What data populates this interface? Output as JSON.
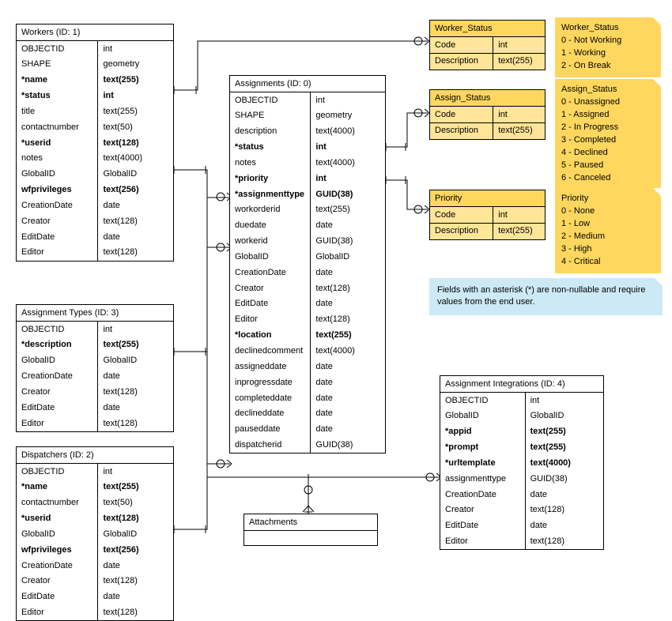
{
  "entities": {
    "workers": {
      "title": "Workers (ID: 1)",
      "fields": [
        {
          "name": "OBJECTID",
          "type": "int",
          "bold": false
        },
        {
          "name": "SHAPE",
          "type": "geometry",
          "bold": false
        },
        {
          "name": "*name",
          "type": "text(255)",
          "bold": true
        },
        {
          "name": "*status",
          "type": "int",
          "bold": true
        },
        {
          "name": "title",
          "type": "text(255)",
          "bold": false
        },
        {
          "name": "contactnumber",
          "type": "text(50)",
          "bold": false
        },
        {
          "name": "*userid",
          "type": "text(128)",
          "bold": true
        },
        {
          "name": "notes",
          "type": "text(4000)",
          "bold": false
        },
        {
          "name": "GlobalID",
          "type": "GlobalID",
          "bold": false
        },
        {
          "name": "wfprivileges",
          "type": "text(256)",
          "bold": true
        },
        {
          "name": "CreationDate",
          "type": "date",
          "bold": false
        },
        {
          "name": "Creator",
          "type": "text(128)",
          "bold": false
        },
        {
          "name": "EditDate",
          "type": "date",
          "bold": false
        },
        {
          "name": "Editor",
          "type": "text(128)",
          "bold": false
        }
      ]
    },
    "assignmentTypes": {
      "title": "Assignment Types (ID: 3)",
      "fields": [
        {
          "name": "OBJECTID",
          "type": "int",
          "bold": false
        },
        {
          "name": "*description",
          "type": "text(255)",
          "bold": true
        },
        {
          "name": "GlobalID",
          "type": "GlobalID",
          "bold": false
        },
        {
          "name": "CreationDate",
          "type": "date",
          "bold": false
        },
        {
          "name": "Creator",
          "type": "text(128)",
          "bold": false
        },
        {
          "name": "EditDate",
          "type": "date",
          "bold": false
        },
        {
          "name": "Editor",
          "type": "text(128)",
          "bold": false
        }
      ]
    },
    "dispatchers": {
      "title": "Dispatchers (ID: 2)",
      "fields": [
        {
          "name": "OBJECTID",
          "type": "int",
          "bold": false
        },
        {
          "name": "*name",
          "type": "text(255)",
          "bold": true
        },
        {
          "name": "contactnumber",
          "type": "text(50)",
          "bold": false
        },
        {
          "name": "*userid",
          "type": "text(128)",
          "bold": true
        },
        {
          "name": "GlobalID",
          "type": "GlobalID",
          "bold": false
        },
        {
          "name": "wfprivileges",
          "type": "text(256)",
          "bold": true
        },
        {
          "name": "CreationDate",
          "type": "date",
          "bold": false
        },
        {
          "name": "Creator",
          "type": "text(128)",
          "bold": false
        },
        {
          "name": "EditDate",
          "type": "date",
          "bold": false
        },
        {
          "name": "Editor",
          "type": "text(128)",
          "bold": false
        }
      ]
    },
    "assignments": {
      "title": "Assignments (ID: 0)",
      "fields": [
        {
          "name": "OBJECTID",
          "type": "int",
          "bold": false
        },
        {
          "name": "SHAPE",
          "type": "geometry",
          "bold": false
        },
        {
          "name": "description",
          "type": "text(4000)",
          "bold": false
        },
        {
          "name": "*status",
          "type": "int",
          "bold": true
        },
        {
          "name": "notes",
          "type": "text(4000)",
          "bold": false
        },
        {
          "name": "*priority",
          "type": "int",
          "bold": true
        },
        {
          "name": "*assignmenttype",
          "type": "GUID(38)",
          "bold": true
        },
        {
          "name": "workorderid",
          "type": "text(255)",
          "bold": false
        },
        {
          "name": "duedate",
          "type": "date",
          "bold": false
        },
        {
          "name": "workerid",
          "type": "GUID(38)",
          "bold": false
        },
        {
          "name": "GlobalID",
          "type": "GlobalID",
          "bold": false
        },
        {
          "name": "CreationDate",
          "type": "date",
          "bold": false
        },
        {
          "name": "Creator",
          "type": "text(128)",
          "bold": false
        },
        {
          "name": "EditDate",
          "type": "date",
          "bold": false
        },
        {
          "name": "Editor",
          "type": "text(128)",
          "bold": false
        },
        {
          "name": "*location",
          "type": "text(255)",
          "bold": true
        },
        {
          "name": "declinedcomment",
          "type": "text(4000)",
          "bold": false
        },
        {
          "name": "assigneddate",
          "type": "date",
          "bold": false
        },
        {
          "name": "inprogressdate",
          "type": "date",
          "bold": false
        },
        {
          "name": "completeddate",
          "type": "date",
          "bold": false
        },
        {
          "name": "declineddate",
          "type": "date",
          "bold": false
        },
        {
          "name": "pauseddate",
          "type": "date",
          "bold": false
        },
        {
          "name": "dispatcherid",
          "type": "GUID(38)",
          "bold": false
        }
      ]
    },
    "integrations": {
      "title": "Assignment Integrations (ID: 4)",
      "fields": [
        {
          "name": "OBJECTID",
          "type": "int",
          "bold": false
        },
        {
          "name": "GlobalID",
          "type": "GlobalID",
          "bold": false
        },
        {
          "name": "*appid",
          "type": "text(255)",
          "bold": true
        },
        {
          "name": "*prompt",
          "type": "text(255)",
          "bold": true
        },
        {
          "name": "*urltemplate",
          "type": "text(4000)",
          "bold": true
        },
        {
          "name": "assignmenttype",
          "type": "GUID(38)",
          "bold": false
        },
        {
          "name": "CreationDate",
          "type": "date",
          "bold": false
        },
        {
          "name": "Creator",
          "type": "text(128)",
          "bold": false
        },
        {
          "name": "EditDate",
          "type": "date",
          "bold": false
        },
        {
          "name": "Editor",
          "type": "text(128)",
          "bold": false
        }
      ]
    },
    "attachments": {
      "title": "Attachments"
    }
  },
  "lookups": {
    "workerStatus": {
      "title": "Worker_Status",
      "rows": [
        [
          "Code",
          "int"
        ],
        [
          "Description",
          "text(255)"
        ]
      ]
    },
    "assignStatus": {
      "title": "Assign_Status",
      "rows": [
        [
          "Code",
          "int"
        ],
        [
          "Description",
          "text(255)"
        ]
      ]
    },
    "priority": {
      "title": "Priority",
      "rows": [
        [
          "Code",
          "int"
        ],
        [
          "Description",
          "text(255)"
        ]
      ]
    }
  },
  "notes": {
    "workerStatus": "Worker_Status\n0 - Not Working\n1 - Working\n2 - On Break",
    "assignStatus": "Assign_Status\n0 - Unassigned\n1 - Assigned\n2 - In Progress\n3 - Completed\n4 - Declined\n5 - Paused\n6 - Canceled",
    "priority": "Priority\n0 - None\n1 - Low\n2 - Medium\n3 - High\n4 - Critical"
  },
  "info": "Fields with an asterisk (*) are non-nullable and require values from the end user."
}
